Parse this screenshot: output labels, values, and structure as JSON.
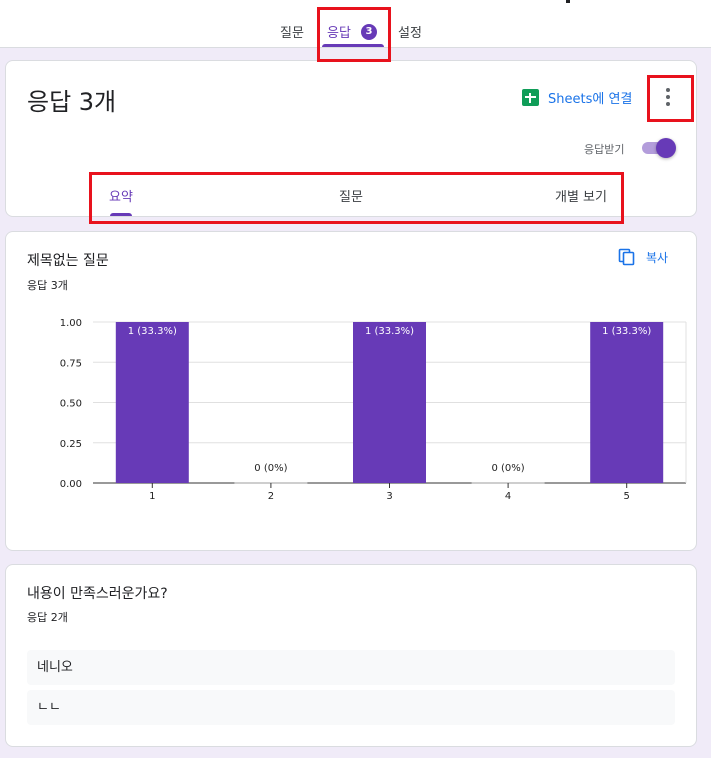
{
  "tabs": [
    {
      "label": "질문"
    },
    {
      "label": "응답",
      "badge": "3"
    },
    {
      "label": "설정"
    }
  ],
  "summary": {
    "title": "응답 3개",
    "sheets_link": "Sheets에 연결",
    "accepting_label": "응답받기",
    "accepting": true,
    "subtabs": [
      "요약",
      "질문",
      "개별 보기"
    ],
    "active_subtab": "요약"
  },
  "question1": {
    "title": "제목없는 질문",
    "response_count": "응답 3개",
    "copy_label": "복사"
  },
  "chart_data": {
    "type": "bar",
    "categories": [
      "1",
      "2",
      "3",
      "4",
      "5"
    ],
    "values": [
      1,
      0,
      1,
      0,
      1
    ],
    "data_labels": [
      "1 (33.3%)",
      "0 (0%)",
      "1 (33.3%)",
      "0 (0%)",
      "1 (33.3%)"
    ],
    "yticks": [
      "0.00",
      "0.25",
      "0.50",
      "0.75",
      "1.00"
    ],
    "ylim": [
      0,
      1
    ],
    "grid": true,
    "color": "#673ab7"
  },
  "question2": {
    "title": "내용이 만족스러운가요?",
    "response_count": "응답 2개",
    "answers": [
      "네니오",
      "ㄴㄴ"
    ]
  },
  "colors": {
    "accent": "#673ab7",
    "link": "#1a73e8",
    "highlight": "#e8121d"
  }
}
